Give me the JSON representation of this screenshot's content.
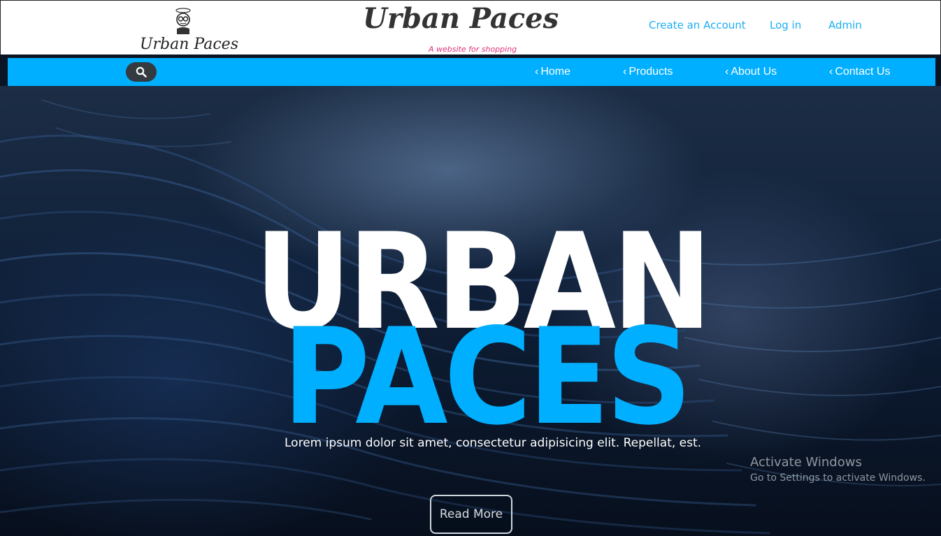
{
  "header": {
    "logo_text": "Urban Paces",
    "title": "Urban Paces",
    "tagline": "A website for shopping",
    "links": [
      {
        "label": "Create an Account"
      },
      {
        "label": "Log in"
      },
      {
        "label": "Admin"
      }
    ]
  },
  "nav": {
    "search_icon": "search-icon",
    "items": [
      {
        "label": "Home",
        "icon": "chevron-left-icon"
      },
      {
        "label": "Products",
        "icon": "chevron-left-icon"
      },
      {
        "label": "About Us",
        "icon": "chevron-left-icon"
      },
      {
        "label": "Contact Us",
        "icon": "chevron-left-icon"
      }
    ]
  },
  "hero": {
    "line1": "URBAN",
    "line2": "PACES",
    "subtitle": "Lorem ipsum dolor sit amet, consectetur adipisicing elit. Repellat, est.",
    "button_label": "Read More"
  },
  "watermark": {
    "title": "Activate Windows",
    "subtitle": "Go to Settings to activate Windows."
  },
  "colors": {
    "accent": "#00afff",
    "link": "#1aaef0",
    "tagline": "#e0307a",
    "search_button": "#333a40"
  }
}
